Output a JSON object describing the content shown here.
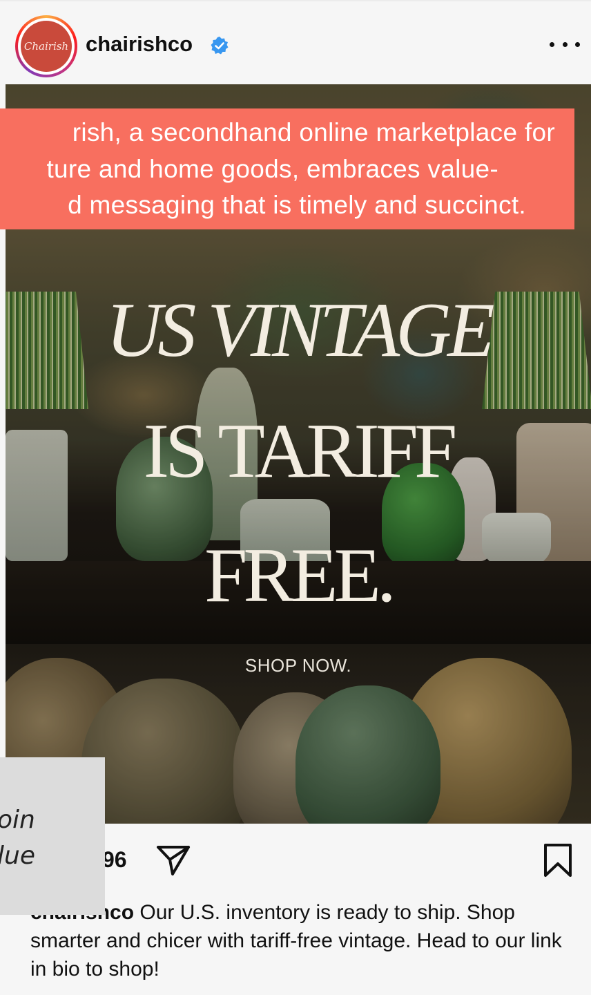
{
  "header": {
    "avatar_text": "Chairish",
    "username": "chairishco",
    "verified_icon": "verified-badge-icon",
    "more_icon": "more-options-icon"
  },
  "banner": {
    "line1": "rish, a secondhand online marketplace for",
    "line2": "ture and home goods, embraces value-",
    "line3": "d messaging that is timely and succinct.",
    "color": "#f86f5f"
  },
  "image": {
    "headline_line1": "US VINTAGE",
    "headline_line2": "IS TARIFF",
    "headline_line3": "FREE.",
    "cta": "SHOP NOW."
  },
  "actions": {
    "count": "96",
    "share_icon": "share-icon",
    "save_icon": "bookmark-icon"
  },
  "caption": {
    "username": "chairishco",
    "text": " Our U.S. inventory is ready to ship. Shop smarter and chicer with tariff-free vintage. Head to our link in bio to shop!"
  },
  "overlay_box": {
    "line1": "oin",
    "line2": "lue"
  }
}
